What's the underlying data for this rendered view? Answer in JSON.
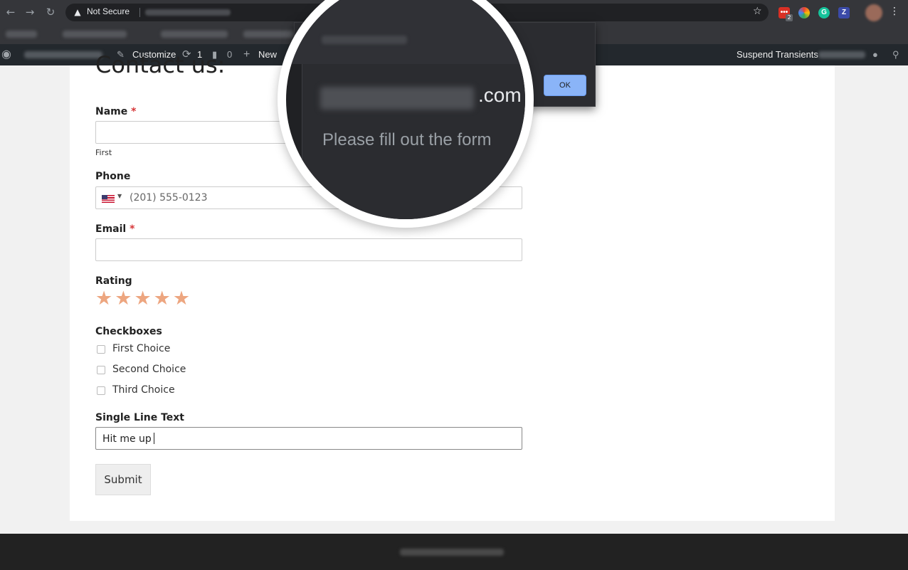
{
  "browser": {
    "security_label": "Not Secure",
    "extension_badge": "2",
    "ext_z_label": "Z"
  },
  "adminbar": {
    "customize": "Customize",
    "updates_count": "1",
    "comments_count": "0",
    "new_label": "New",
    "suspend_transients": "Suspend Transients"
  },
  "page": {
    "title": "Contact us:"
  },
  "form": {
    "name_label": "Name",
    "required_mark": "*",
    "name_first_sublabel": "First",
    "phone_label": "Phone",
    "phone_placeholder": "(201) 555-0123",
    "email_label": "Email",
    "rating_label": "Rating",
    "rating_max": 5,
    "checkboxes_label": "Checkboxes",
    "checkbox_options": [
      "First Choice",
      "Second Choice",
      "Third Choice"
    ],
    "single_line_label": "Single Line Text",
    "single_line_value": "Hit me up",
    "submit_label": "Submit"
  },
  "dialog": {
    "domain_suffix": ".com",
    "message": "Please fill out the form",
    "ok_label": "OK"
  },
  "colors": {
    "star": "#eda680",
    "required": "#d63638",
    "ok_button": "#8ab4f8"
  }
}
